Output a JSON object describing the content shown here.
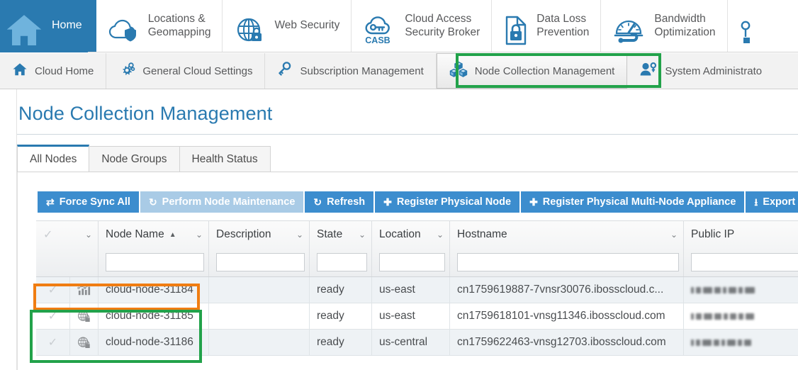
{
  "top_nav": {
    "items": [
      {
        "label": "Home",
        "icon": "house-icon",
        "active": true
      },
      {
        "label": "Locations &\nGeomapping",
        "icon": "cloud-shield-icon",
        "active": false
      },
      {
        "label": "Web Security",
        "icon": "globe-lock-icon",
        "active": false
      },
      {
        "label": "Cloud Access\nSecurity Broker",
        "icon": "casb-cloud-key-icon",
        "active": false
      },
      {
        "label": "Data Loss\nPrevention",
        "icon": "document-lock-icon",
        "active": false
      },
      {
        "label": "Bandwidth\nOptimization",
        "icon": "gauge-wrench-icon",
        "active": false
      },
      {
        "label": "",
        "icon": "key-icon",
        "active": false
      }
    ]
  },
  "sub_nav": {
    "items": [
      {
        "label": "Cloud Home",
        "icon": "house-icon",
        "active": false
      },
      {
        "label": "General Cloud Settings",
        "icon": "gears-icon",
        "active": false
      },
      {
        "label": "Subscription Management",
        "icon": "key-icon",
        "active": false
      },
      {
        "label": "Node Collection Management",
        "icon": "cubes-icon",
        "active": true
      },
      {
        "label": "System Administrato",
        "icon": "user-key-icon",
        "active": false
      }
    ]
  },
  "page": {
    "title": "Node Collection Management"
  },
  "tabs": [
    {
      "label": "All Nodes",
      "active": true
    },
    {
      "label": "Node Groups",
      "active": false
    },
    {
      "label": "Health Status",
      "active": false
    }
  ],
  "toolbar": {
    "buttons": [
      {
        "label": "Force Sync All",
        "icon": "sync-arrows-icon",
        "disabled": false
      },
      {
        "label": "Perform Node Maintenance",
        "icon": "refresh-icon",
        "disabled": true
      },
      {
        "label": "Refresh",
        "icon": "refresh-icon",
        "disabled": false
      },
      {
        "label": "Register Physical Node",
        "icon": "plus-icon",
        "disabled": false
      },
      {
        "label": "Register Physical Multi-Node Appliance",
        "icon": "plus-icon",
        "disabled": false
      },
      {
        "label": "Export No",
        "icon": "export-download-icon",
        "disabled": false
      }
    ]
  },
  "table": {
    "columns": [
      {
        "label": "",
        "key": "select",
        "sorted": false,
        "has_filter": false
      },
      {
        "label": "Node Name",
        "key": "node_name",
        "sorted": "asc",
        "has_filter": true
      },
      {
        "label": "Description",
        "key": "description",
        "sorted": false,
        "has_filter": true
      },
      {
        "label": "State",
        "key": "state",
        "sorted": false,
        "has_filter": true
      },
      {
        "label": "Location",
        "key": "location",
        "sorted": false,
        "has_filter": true
      },
      {
        "label": "Hostname",
        "key": "hostname",
        "sorted": false,
        "has_filter": true
      },
      {
        "label": "Public IP",
        "key": "public_ip",
        "sorted": false,
        "has_filter": true
      }
    ],
    "filters": {
      "node_name": "",
      "description": "",
      "state": "",
      "location": "",
      "hostname": "",
      "public_ip": ""
    },
    "rows": [
      {
        "type_icon": "analytics-chart-icon",
        "node_name": "cloud-node-31184",
        "description": "",
        "state": "ready",
        "location": "us-east",
        "hostname": "cn1759619887-7vnsr30076.ibosscloud.c...",
        "public_ip": "",
        "public_ip_redacted": true
      },
      {
        "type_icon": "globe-lock-icon",
        "node_name": "cloud-node-31185",
        "description": "",
        "state": "ready",
        "location": "us-east",
        "hostname": "cn1759618101-vnsg11346.ibosscloud.com",
        "public_ip": "",
        "public_ip_redacted": true
      },
      {
        "type_icon": "globe-lock-icon",
        "node_name": "cloud-node-31186",
        "description": "",
        "state": "ready",
        "location": "us-central",
        "hostname": "cn1759622463-vnsg12703.ibosscloud.com",
        "public_ip": "",
        "public_ip_redacted": true
      }
    ]
  },
  "annotations": {
    "green_tab_color": "#22a24a",
    "orange_row_color": "#f07d12",
    "green_rows_color": "#22a24a"
  },
  "colors": {
    "brand_blue": "#2a7ab0",
    "button_blue": "#3c8dce",
    "button_blue_disabled": "#a9cbe6",
    "row_alt": "#eef2f5"
  }
}
